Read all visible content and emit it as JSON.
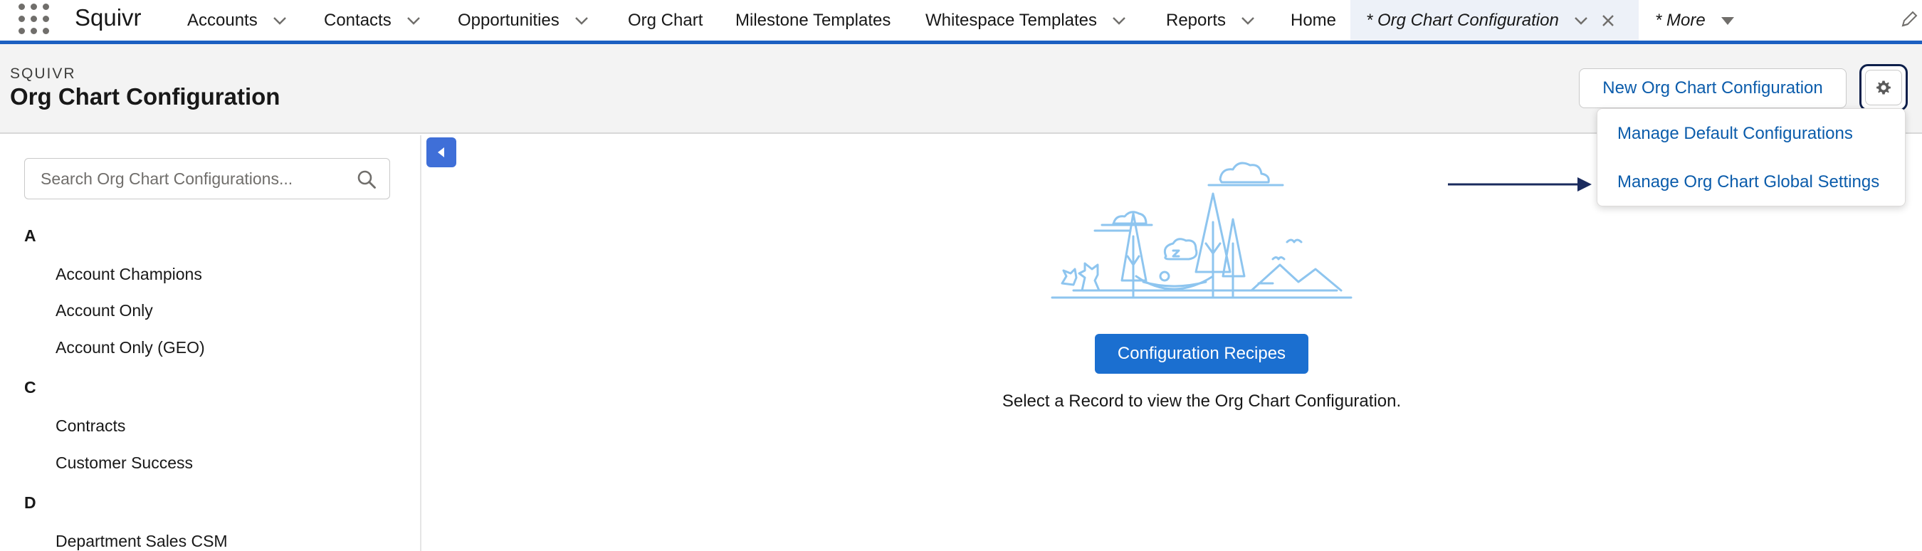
{
  "app": {
    "name": "Squivr"
  },
  "nav": {
    "items": [
      {
        "label": "Accounts",
        "dropdown": true
      },
      {
        "label": "Contacts",
        "dropdown": true
      },
      {
        "label": "Opportunities",
        "dropdown": true
      },
      {
        "label": "Org Chart",
        "dropdown": false
      },
      {
        "label": "Milestone Templates",
        "dropdown": false
      },
      {
        "label": "Whitespace Templates",
        "dropdown": true
      },
      {
        "label": "Reports",
        "dropdown": true
      },
      {
        "label": "Home",
        "dropdown": false
      }
    ],
    "active_tab": {
      "label": "* Org Chart Configuration"
    },
    "more": {
      "label": "* More"
    }
  },
  "header": {
    "eyebrow": "SQUIVR",
    "title": "Org Chart Configuration",
    "new_button": "New Org Chart Configuration"
  },
  "settings_menu": {
    "items": [
      "Manage Default Configurations",
      "Manage Org Chart Global Settings"
    ]
  },
  "sidebar": {
    "search_placeholder": "Search Org Chart Configurations...",
    "groups": [
      {
        "letter": "A",
        "items": [
          "Account Champions",
          "Account Only",
          "Account Only (GEO)"
        ]
      },
      {
        "letter": "C",
        "items": [
          "Contracts",
          "Customer Success"
        ]
      },
      {
        "letter": "D",
        "items": [
          "Department Sales CSM"
        ]
      }
    ]
  },
  "main": {
    "recipes_button": "Configuration Recipes",
    "empty_message": "Select a Record to view the Org Chart Configuration."
  },
  "colors": {
    "brand_blue": "#1b5fc1",
    "link_blue": "#0b5cab",
    "button_blue": "#1b6fd0",
    "illustration_blue": "#8ec5ef"
  }
}
